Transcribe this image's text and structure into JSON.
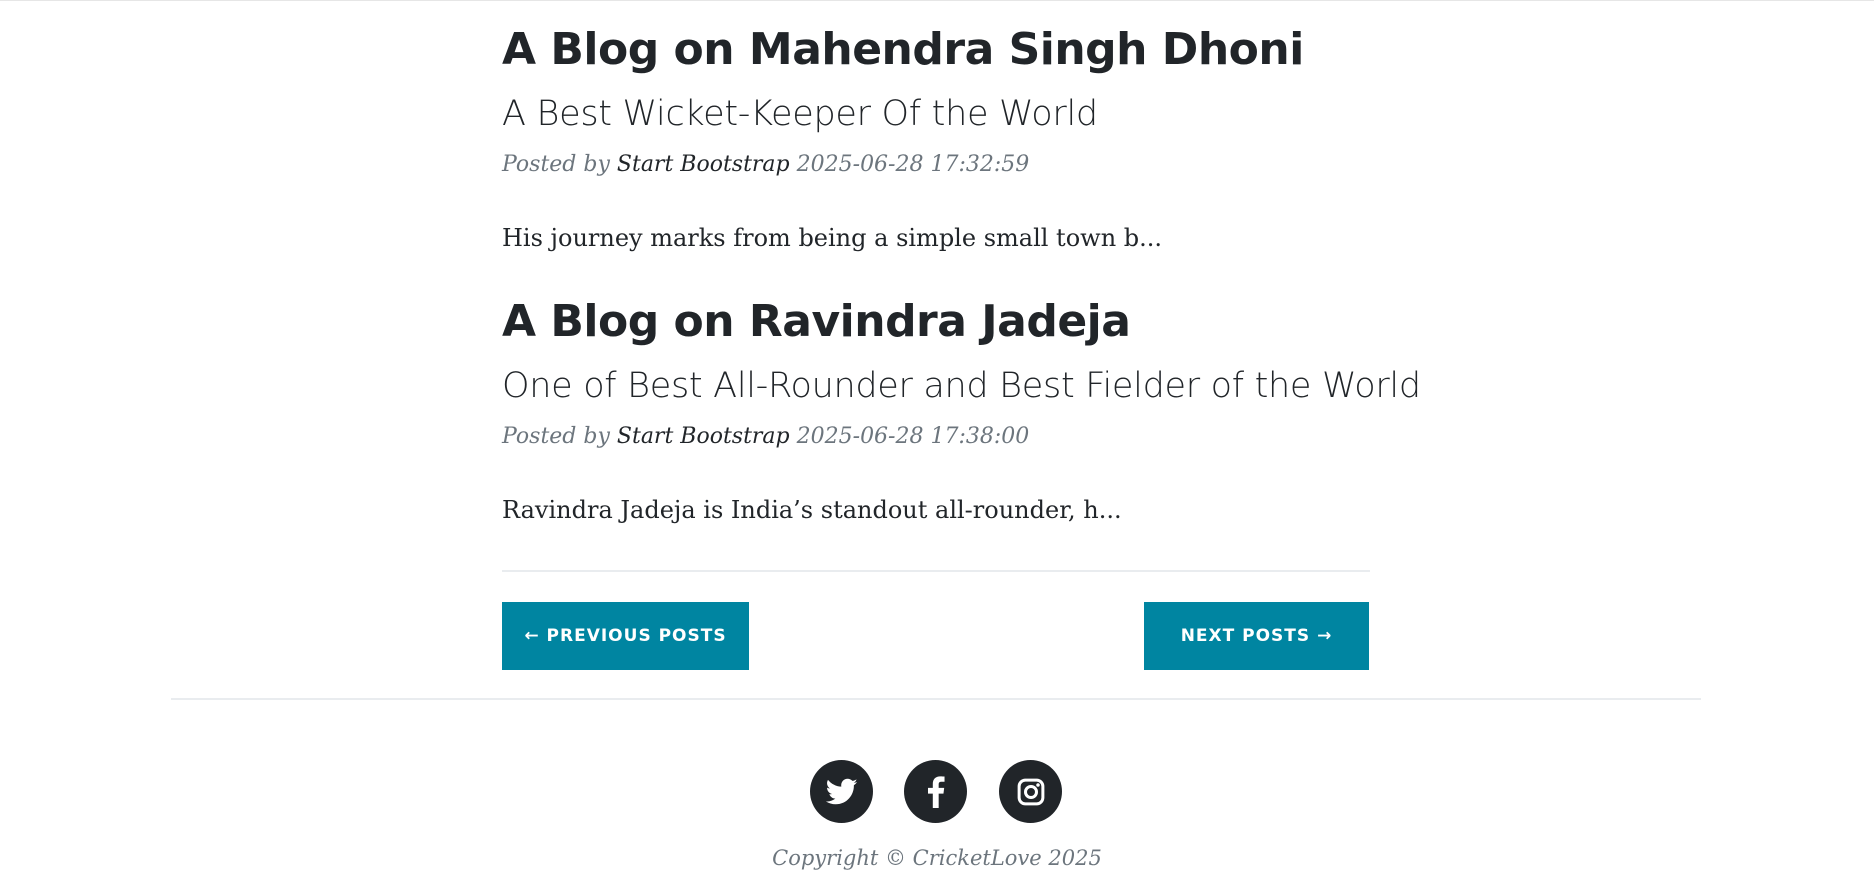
{
  "posts": [
    {
      "title": "A Blog on Mahendra Singh Dhoni",
      "subtitle": "A Best Wicket-Keeper Of the World",
      "meta_prefix": "Posted by",
      "author": "Start Bootstrap",
      "timestamp": "2025-06-28 17:32:59",
      "excerpt": "His journey marks from being a simple small town b..."
    },
    {
      "title": "A Blog on Ravindra Jadeja",
      "subtitle": "One of Best All-Rounder and Best Fielder of the World",
      "meta_prefix": "Posted by",
      "author": "Start Bootstrap",
      "timestamp": "2025-06-28 17:38:00",
      "excerpt": "Ravindra Jadeja is India’s standout all-rounder, h..."
    }
  ],
  "pager": {
    "previous_label": "← Previous Posts",
    "next_label": "Next Posts →"
  },
  "footer": {
    "social": [
      {
        "icon": "twitter-icon"
      },
      {
        "icon": "facebook-icon"
      },
      {
        "icon": "instagram-icon"
      }
    ],
    "copyright": "Copyright © CricketLove 2025"
  },
  "colors": {
    "accent": "#0085a1",
    "text": "#212529",
    "muted": "#6c757d"
  }
}
